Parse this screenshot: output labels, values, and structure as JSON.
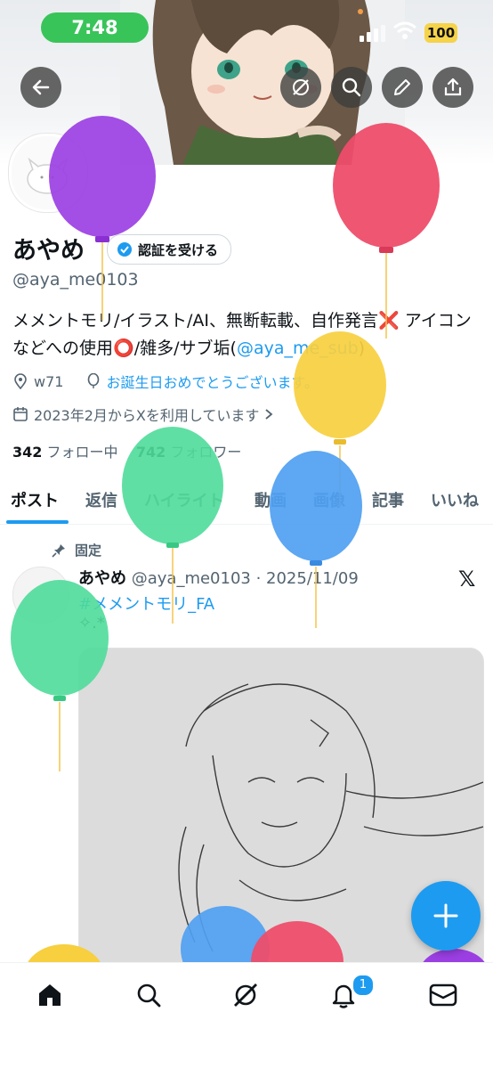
{
  "status_bar": {
    "time": "7:48",
    "battery": "100"
  },
  "profile": {
    "name": "あやめ",
    "verify_label": "認証を受ける",
    "handle": "@aya_me0103",
    "bio_text": "メメントモリ/イラスト/AI、無断転載、自作発言❌ アイコンなどへの使用⭕️/雑多/サブ垢(",
    "bio_link": "@aya_me_sub",
    "bio_end": ")",
    "location": "w71",
    "birthday": "お誕生日おめでとうございます。",
    "joined": "2023年2月からXを利用しています",
    "following_count": "342",
    "following_label": "フォロー中",
    "followers_count": "742",
    "followers_label": "フォロワー"
  },
  "tabs": [
    "ポスト",
    "返信",
    "ハイライト",
    "動画",
    "画像",
    "記事",
    "いいね"
  ],
  "post": {
    "pinned_label": "固定",
    "author": "あやめ",
    "handle_date": "@aya_me0103 · 2025/11/09",
    "hashtag": "#メメントモリ_FA",
    "text": "✧.*"
  },
  "notifications_badge": "1",
  "icons": [
    "back-arrow-icon",
    "grok-icon",
    "search-icon",
    "pencil-icon",
    "share-icon",
    "pin-icon",
    "x-logo-icon",
    "home-icon",
    "search-icon",
    "grok-icon",
    "bell-icon",
    "mail-icon",
    "plus-icon"
  ],
  "colors": {
    "accent": "#1d9bf0",
    "time_pill": "#39c45a"
  }
}
